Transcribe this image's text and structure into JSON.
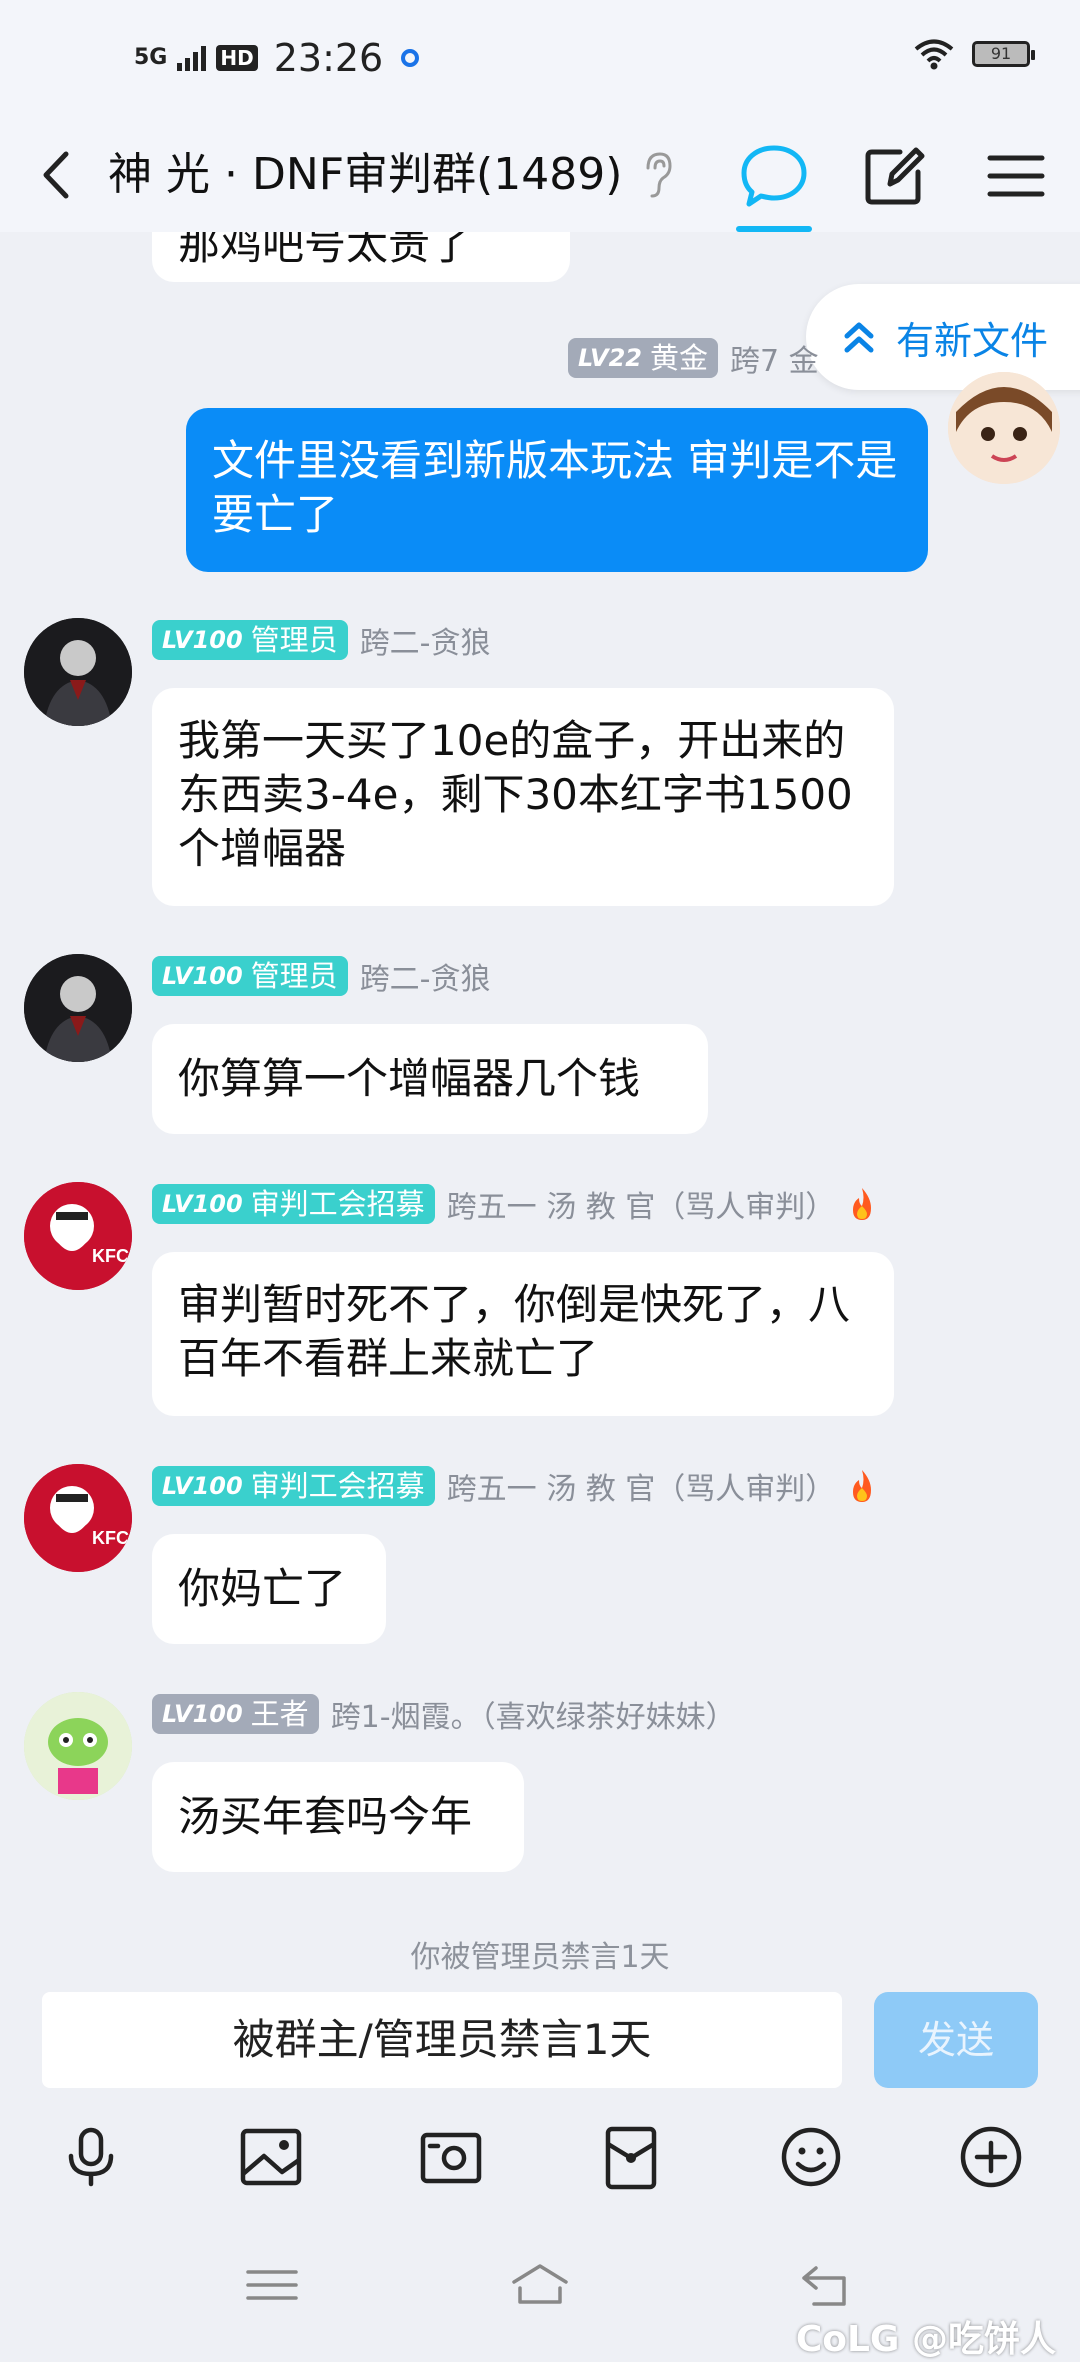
{
  "status_bar": {
    "signal_label": "5G",
    "hd_label": "HD",
    "time": "23:26",
    "battery": "91"
  },
  "header": {
    "title": "神 光 · DNF审判群(1489)"
  },
  "banner": {
    "new_file_label": "有新文件"
  },
  "messages": {
    "top_cut_text": "那鸡吧号太贵了",
    "self": {
      "level": "LV22",
      "rank": "黄金",
      "name": "跨7 金",
      "text": "文件里没看到新版本玩法 审判是不是要亡了"
    },
    "m1": {
      "level": "LV100",
      "title": "管理员",
      "name": "跨二-贪狼",
      "text": "我第一天买了10e的盒子，开出来的东西卖3-4e，剩下30本红字书1500个增幅器"
    },
    "m2": {
      "level": "LV100",
      "title": "管理员",
      "name": "跨二-贪狼",
      "text": "你算算一个增幅器几个钱"
    },
    "m3": {
      "level": "LV100",
      "title": "审判工会招募",
      "name": "跨五一 汤 教 官（骂人审判）",
      "text": "审判暂时死不了，你倒是快死了，八百年不看群上来就亡了"
    },
    "m4": {
      "level": "LV100",
      "title": "审判工会招募",
      "name": "跨五一 汤 教 官（骂人审判）",
      "text": "你妈亡了"
    },
    "m5": {
      "level": "LV100",
      "title": "王者",
      "name": "跨1-烟霞。（喜欢绿茶好妹妹）",
      "text": "汤买年套吗今年"
    },
    "system_notice": "你被管理员禁言1天"
  },
  "input": {
    "value": "被群主/管理员禁言1天",
    "send_label": "发送"
  },
  "avatars": {
    "kfc_label": "KFC"
  },
  "watermark": "CoLG @吃饼人",
  "colors": {
    "accent": "#12b7f5",
    "self_bubble": "#0a8cf7",
    "badge_teal": "#3ad0cd",
    "badge_gray": "#a3aab8"
  }
}
